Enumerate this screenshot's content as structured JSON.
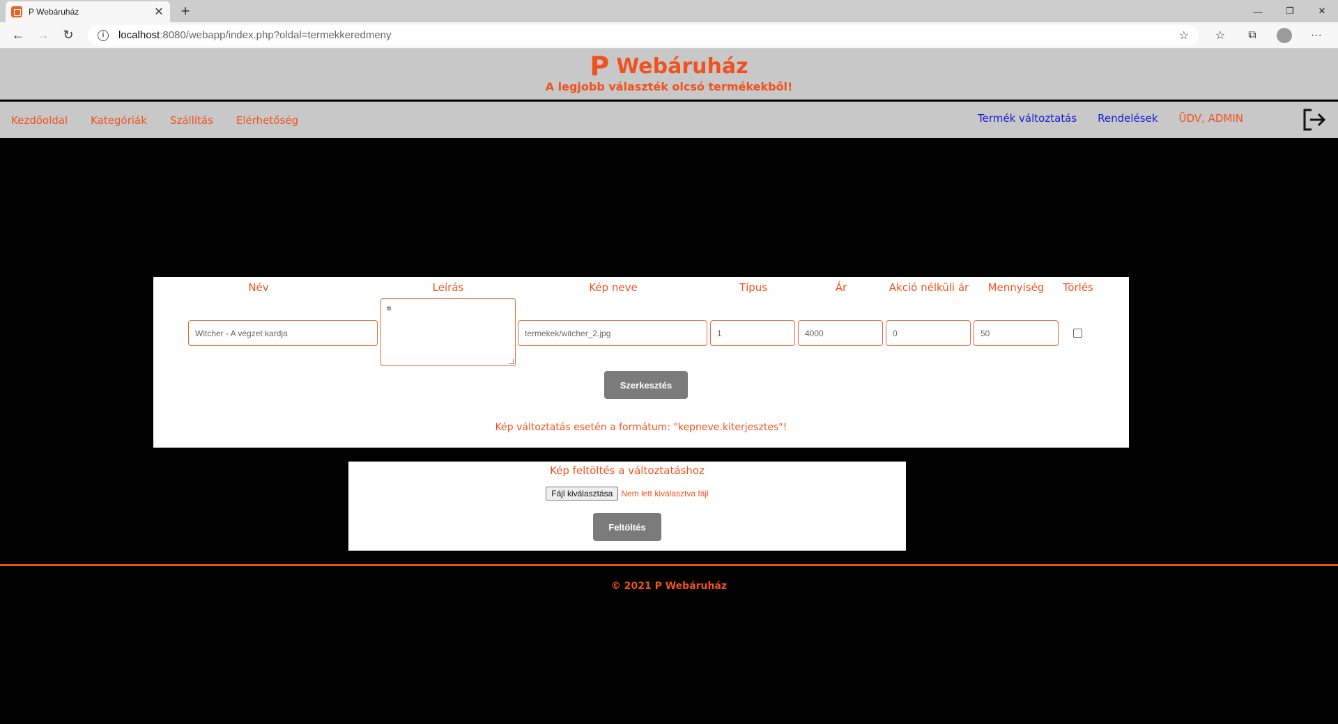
{
  "browser": {
    "tab_title": "P Webáruház",
    "tab_close": "✕",
    "new_tab": "+",
    "url_host": "localhost",
    "url_rest": ":8080/webapp/index.php?oldal=termekkeredmeny",
    "min": "—",
    "restore": "❐",
    "close": "✕"
  },
  "header": {
    "logo_mark": "P",
    "title": "Webáruház",
    "subtitle": "A legjobb választék olcsó termékekből!"
  },
  "menu": {
    "left": [
      "Kezdőoldal",
      "Kategóriák",
      "Szállítás",
      "Elérhetőség"
    ],
    "right": [
      {
        "label": "Termék változtatás",
        "color": "#1818d8"
      },
      {
        "label": "Rendelések",
        "color": "#1818d8"
      },
      {
        "label": "ÜDV, ADMIN",
        "color": "#f0521e"
      }
    ]
  },
  "form": {
    "headers": {
      "nev": "Név",
      "leiras": "Leírás",
      "kep": "Kép neve",
      "tipus": "Típus",
      "ar": "Ár",
      "akcio": "Akció nélküli ár",
      "mennyiseg": "Mennyiség",
      "torles": "Törlés"
    },
    "values": {
      "nev": "Witcher - A végzet kardja",
      "leiras": "m",
      "kep": "termekek/witcher_2.jpg",
      "tipus": "1",
      "ar": "4000",
      "akcio": "0",
      "mennyiseg": "50"
    },
    "torles_checked": false,
    "submit_label": "Szerkesztés",
    "note": "Kép változtatás esetén a formátum: \"kepneve.kiterjesztes\"!"
  },
  "upload": {
    "title": "Kép feltöltés a változtatáshoz",
    "file_button": "Fájl kiválasztása",
    "file_none": "Nem lett kiválasztva fájl",
    "submit_label": "Feltöltés"
  },
  "footer": {
    "text": "© 2021 P Webáruház"
  },
  "colors": {
    "accent": "#f0521e",
    "nav_blue": "#1818d8",
    "header_bg": "#c8c8c8"
  }
}
